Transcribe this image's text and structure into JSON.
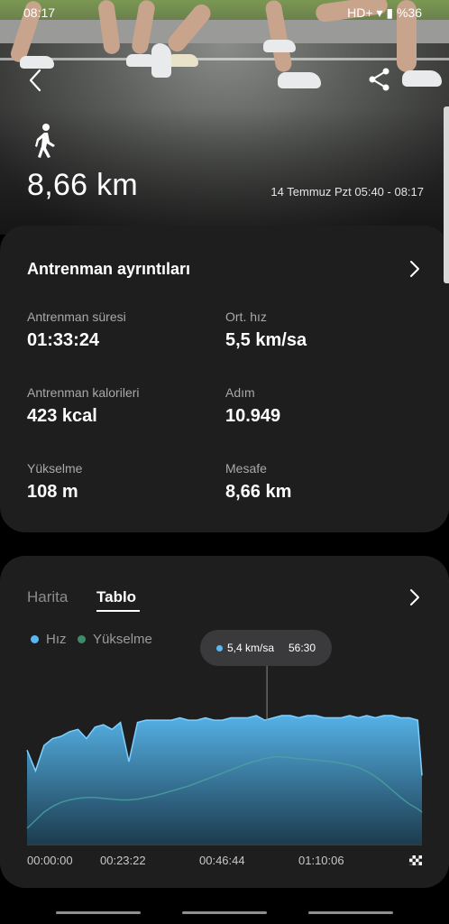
{
  "status": {
    "time": "08:17",
    "right": "HD+ ▾ ▮ %36"
  },
  "header": {
    "distance": "8,66 km",
    "date_range": "14 Temmuz Pzt 05:40 - 08:17"
  },
  "details": {
    "title": "Antrenman ayrıntıları",
    "metrics": [
      {
        "label": "Antrenman süresi",
        "value": "01:33:24"
      },
      {
        "label": "Ort. hız",
        "value": "5,5 km/sa"
      },
      {
        "label": "Antrenman kalorileri",
        "value": "423 kcal"
      },
      {
        "label": "Adım",
        "value": "10.949"
      },
      {
        "label": "Yükselme",
        "value": "108 m"
      },
      {
        "label": "Mesafe",
        "value": "8,66 km"
      }
    ]
  },
  "chart_card": {
    "tabs": [
      "Harita",
      "Tablo"
    ],
    "active_tab": "Tablo",
    "legend": [
      "Hız",
      "Yükselme"
    ],
    "tooltip": {
      "value": "5,4 km/sa",
      "time": "56:30"
    }
  },
  "colors": {
    "speed": "#58b9f0",
    "elevation": "#3f8a6a",
    "card": "#1e1e1f"
  },
  "chart_data": {
    "type": "area",
    "x_tick_labels": [
      "00:00:00",
      "00:23:22",
      "00:46:44",
      "01:10:06"
    ],
    "x": [
      0,
      2,
      4,
      6,
      8,
      10,
      12,
      14,
      16,
      18,
      20,
      22,
      24,
      26,
      28,
      30,
      32,
      34,
      36,
      38,
      40,
      42,
      44,
      46,
      48,
      50,
      52,
      54,
      56,
      58,
      60,
      62,
      64,
      66,
      68,
      70,
      72,
      74,
      76,
      78,
      80,
      82,
      84,
      86,
      88,
      90,
      92,
      93
    ],
    "series": [
      {
        "name": "Hız",
        "values": [
          4.1,
          3.2,
          4.3,
          4.6,
          4.7,
          4.9,
          5.0,
          4.6,
          5.1,
          5.2,
          5.0,
          5.3,
          3.6,
          5.3,
          5.4,
          5.4,
          5.4,
          5.4,
          5.5,
          5.4,
          5.4,
          5.5,
          5.4,
          5.4,
          5.5,
          5.5,
          5.5,
          5.6,
          5.4,
          5.5,
          5.6,
          5.6,
          5.5,
          5.6,
          5.6,
          5.5,
          5.5,
          5.5,
          5.6,
          5.5,
          5.6,
          5.5,
          5.6,
          5.6,
          5.5,
          5.5,
          5.4,
          3.0
        ]
      },
      {
        "name": "Yükselme",
        "values": [
          20,
          30,
          40,
          47,
          52,
          55,
          57,
          58,
          58,
          57,
          56,
          55,
          55,
          56,
          58,
          60,
          63,
          66,
          69,
          72,
          76,
          80,
          84,
          88,
          92,
          96,
          100,
          103,
          106,
          108,
          108,
          107,
          106,
          105,
          104,
          103,
          102,
          100,
          98,
          95,
          90,
          84,
          76,
          67,
          58,
          50,
          44,
          40
        ]
      }
    ],
    "grid": false,
    "legend_position": "top-left"
  }
}
